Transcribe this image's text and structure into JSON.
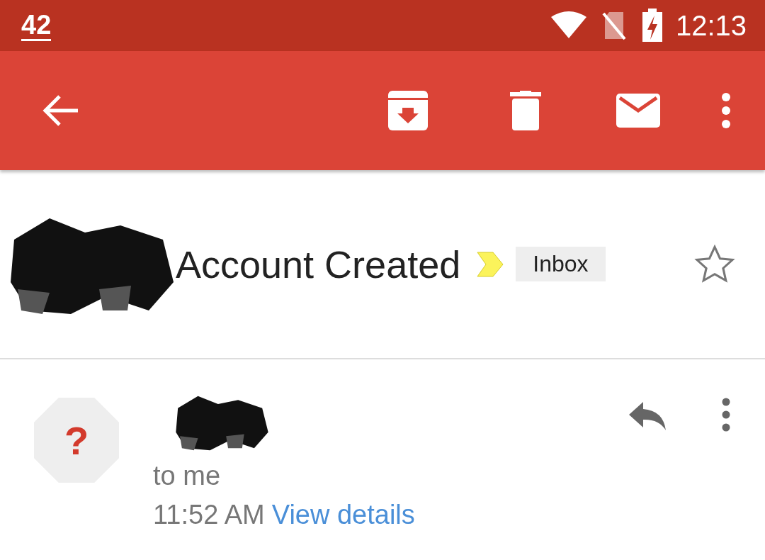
{
  "status_bar": {
    "notification": "42",
    "time": "12:13"
  },
  "subject": {
    "title": "Account Created",
    "label": "Inbox",
    "starred": false
  },
  "message": {
    "avatar": "?",
    "recipient": "to me",
    "time": "11:52 AM",
    "details_link": "View details"
  }
}
